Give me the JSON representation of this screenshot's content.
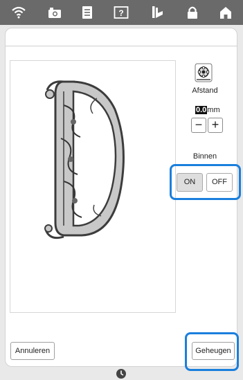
{
  "topbar": {
    "icons": [
      "wifi-icon",
      "camera-icon",
      "document-icon",
      "help-icon",
      "presser-foot-icon",
      "lock-icon",
      "home-icon"
    ]
  },
  "panel": {
    "spacing_label": "Afstand",
    "spacing_value": "0.0",
    "spacing_unit": "mm",
    "minus_label": "−",
    "plus_label": "+",
    "inner_label": "Binnen",
    "on_label": "ON",
    "off_label": "OFF",
    "selected_toggle": "ON"
  },
  "footer": {
    "cancel_label": "Annuleren",
    "save_label": "Geheugen"
  },
  "colors": {
    "topbar": "#6a6a6a",
    "highlight": "#1a7fdd",
    "letter_fill": "#c8c8c8"
  }
}
